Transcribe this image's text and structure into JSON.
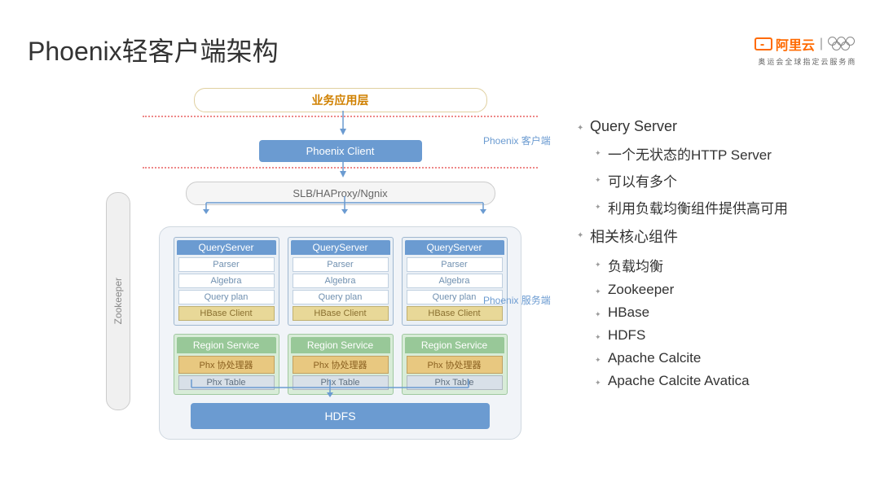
{
  "title": "Phoenix轻客户端架构",
  "logo": {
    "brand": "阿里云",
    "tagline": "奥运会全球指定云服务商"
  },
  "diagram": {
    "app_layer": "业务应用层",
    "client": "Phoenix Client",
    "slb": "SLB/HAProxy/Ngnix",
    "label_client": "Phoenix 客户端",
    "label_server": "Phoenix 服务端",
    "query_server": {
      "title": "QueryServer",
      "parser": "Parser",
      "algebra": "Algebra",
      "plan": "Query plan",
      "hbase": "HBase Client"
    },
    "region_service": {
      "title": "Region Service",
      "proc": "Phx 协处理器",
      "table": "Phx Table"
    },
    "hdfs": "HDFS",
    "zookeeper": "Zookeeper"
  },
  "bullets": {
    "a": "Query Server",
    "a1": "一个无状态的HTTP Server",
    "a2": "可以有多个",
    "a3": "利用负载均衡组件提供高可用",
    "b": "相关核心组件",
    "b1": "负载均衡",
    "b2": "Zookeeper",
    "b3": "HBase",
    "b4": "HDFS",
    "b5": "Apache Calcite",
    "b6": "Apache Calcite Avatica"
  }
}
